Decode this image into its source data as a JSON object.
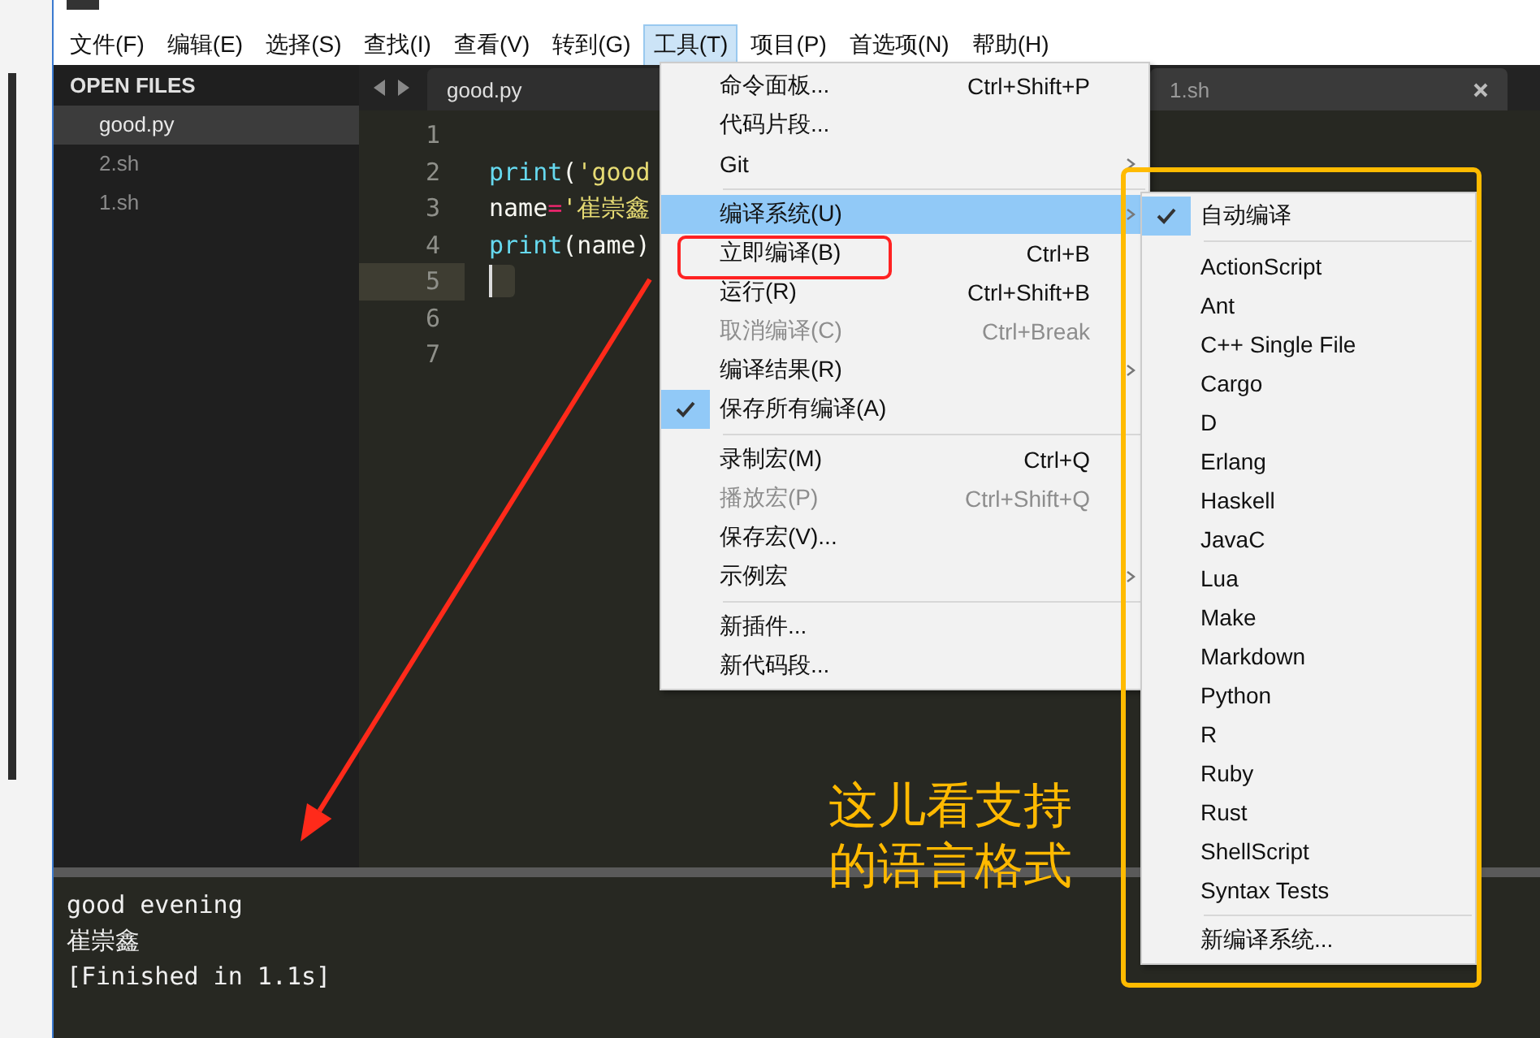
{
  "menu_bar": [
    {
      "label": "文件(F)",
      "selected": false
    },
    {
      "label": "编辑(E)",
      "selected": false
    },
    {
      "label": "选择(S)",
      "selected": false
    },
    {
      "label": "查找(I)",
      "selected": false
    },
    {
      "label": "查看(V)",
      "selected": false
    },
    {
      "label": "转到(G)",
      "selected": false
    },
    {
      "label": "工具(T)",
      "selected": true
    },
    {
      "label": "项目(P)",
      "selected": false
    },
    {
      "label": "首选项(N)",
      "selected": false
    },
    {
      "label": "帮助(H)",
      "selected": false
    }
  ],
  "sidebar": {
    "title": "OPEN FILES",
    "items": [
      {
        "label": "good.py",
        "selected": true
      },
      {
        "label": "2.sh",
        "selected": false
      },
      {
        "label": "1.sh",
        "selected": false
      }
    ]
  },
  "tabs": [
    {
      "label": "good.py",
      "selected": true
    },
    {
      "label": "1.sh",
      "selected": false
    }
  ],
  "editor": {
    "lines": [
      {
        "number": "1",
        "current": false
      },
      {
        "number": "2",
        "current": false,
        "tokens": [
          {
            "kind": "func",
            "text": "print"
          },
          {
            "kind": "plain",
            "text": "("
          },
          {
            "kind": "string",
            "text": "'good"
          }
        ]
      },
      {
        "number": "3",
        "current": false,
        "tokens": [
          {
            "kind": "plain",
            "text": "name"
          },
          {
            "kind": "op",
            "text": "="
          },
          {
            "kind": "string",
            "text": "'崔崇鑫"
          }
        ]
      },
      {
        "number": "4",
        "current": false,
        "tokens": [
          {
            "kind": "func",
            "text": "print"
          },
          {
            "kind": "plain",
            "text": "(name)"
          }
        ]
      },
      {
        "number": "5",
        "current": true
      },
      {
        "number": "6",
        "current": false
      },
      {
        "number": "7",
        "current": false
      }
    ]
  },
  "output": {
    "lines": [
      "good evening",
      "崔崇鑫",
      "[Finished in 1.1s]"
    ]
  },
  "tools_menu": {
    "groups": [
      [
        {
          "label": "命令面板...",
          "shortcut": "Ctrl+Shift+P",
          "selected": false,
          "checked": false,
          "disabled": false,
          "submenu": false
        },
        {
          "label": "代码片段...",
          "selected": false,
          "checked": false,
          "disabled": false,
          "submenu": false
        },
        {
          "label": "Git",
          "selected": false,
          "checked": false,
          "disabled": false,
          "submenu": true
        }
      ],
      [
        {
          "label": "编译系统(U)",
          "selected": true,
          "checked": false,
          "disabled": false,
          "submenu": true
        },
        {
          "label": "立即编译(B)",
          "shortcut": "Ctrl+B",
          "selected": false,
          "checked": false,
          "disabled": false,
          "submenu": false
        },
        {
          "label": "运行(R)",
          "shortcut": "Ctrl+Shift+B",
          "selected": false,
          "checked": false,
          "disabled": false,
          "submenu": false
        },
        {
          "label": "取消编译(C)",
          "shortcut": "Ctrl+Break",
          "selected": false,
          "checked": false,
          "disabled": true,
          "submenu": false
        },
        {
          "label": "编译结果(R)",
          "selected": false,
          "checked": false,
          "disabled": false,
          "submenu": true
        },
        {
          "label": "保存所有编译(A)",
          "selected": false,
          "checked": true,
          "disabled": false,
          "submenu": false
        }
      ],
      [
        {
          "label": "录制宏(M)",
          "shortcut": "Ctrl+Q",
          "selected": false,
          "checked": false,
          "disabled": false,
          "submenu": false
        },
        {
          "label": "播放宏(P)",
          "shortcut": "Ctrl+Shift+Q",
          "selected": false,
          "checked": false,
          "disabled": true,
          "submenu": false
        },
        {
          "label": "保存宏(V)...",
          "selected": false,
          "checked": false,
          "disabled": false,
          "submenu": false
        },
        {
          "label": "示例宏",
          "selected": false,
          "checked": false,
          "disabled": false,
          "submenu": true
        }
      ],
      [
        {
          "label": "新插件...",
          "selected": false,
          "checked": false,
          "disabled": false,
          "submenu": false
        },
        {
          "label": "新代码段...",
          "selected": false,
          "checked": false,
          "disabled": false,
          "submenu": false
        }
      ]
    ]
  },
  "build_system_menu": {
    "groups": [
      [
        {
          "label": "自动编译",
          "checked": true
        }
      ],
      [
        {
          "label": "ActionScript",
          "checked": false
        },
        {
          "label": "Ant",
          "checked": false
        },
        {
          "label": "C++ Single File",
          "checked": false
        },
        {
          "label": "Cargo",
          "checked": false
        },
        {
          "label": "D",
          "checked": false
        },
        {
          "label": "Erlang",
          "checked": false
        },
        {
          "label": "Haskell",
          "checked": false
        },
        {
          "label": "JavaC",
          "checked": false
        },
        {
          "label": "Lua",
          "checked": false
        },
        {
          "label": "Make",
          "checked": false
        },
        {
          "label": "Markdown",
          "checked": false
        },
        {
          "label": "Python",
          "checked": false
        },
        {
          "label": "R",
          "checked": false
        },
        {
          "label": "Ruby",
          "checked": false
        },
        {
          "label": "Rust",
          "checked": false
        },
        {
          "label": "ShellScript",
          "checked": false
        },
        {
          "label": "Syntax Tests",
          "checked": false
        }
      ],
      [
        {
          "label": "新编译系统...",
          "checked": false
        }
      ]
    ]
  },
  "annotation": {
    "lines": [
      "这儿看支持",
      "的语言格式"
    ]
  }
}
